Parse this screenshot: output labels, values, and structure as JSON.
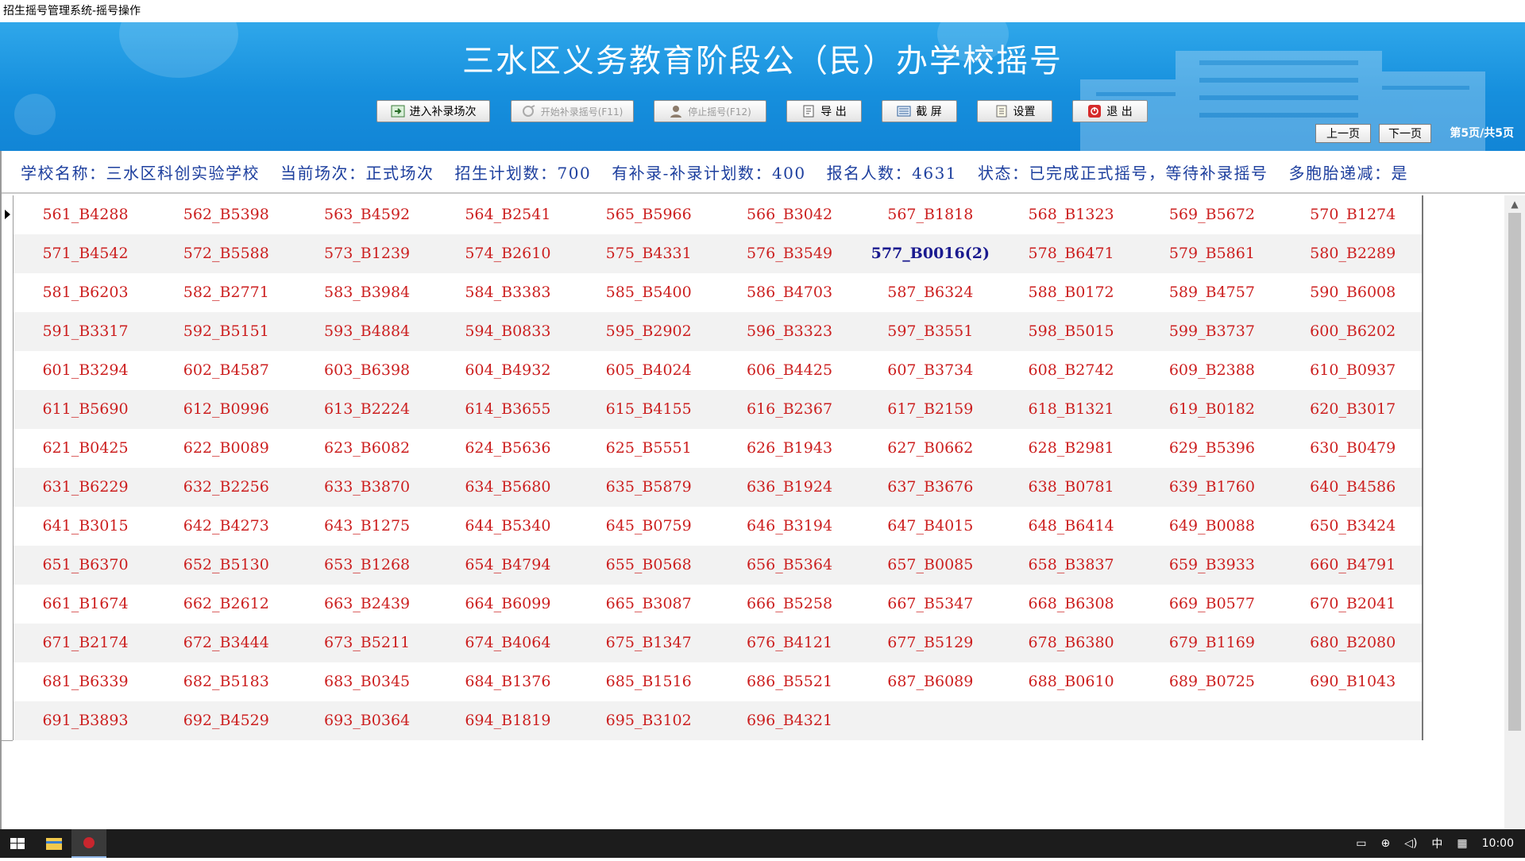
{
  "window": {
    "title": "招生摇号管理系统-摇号操作"
  },
  "banner": {
    "title": "三水区义务教育阶段公（民）办学校摇号"
  },
  "toolbar": {
    "buttons": [
      {
        "label": "进入补录场次",
        "icon": "enter-icon",
        "enabled": true
      },
      {
        "label": "开始补录摇号(F11)",
        "icon": "start-lottery-icon",
        "enabled": false
      },
      {
        "label": "停止摇号(F12)",
        "icon": "stop-lottery-icon",
        "enabled": false
      },
      {
        "label": "导 出",
        "icon": "export-icon",
        "enabled": true
      },
      {
        "label": "截 屏",
        "icon": "screenshot-icon",
        "enabled": true
      },
      {
        "label": "设置",
        "icon": "settings-icon",
        "enabled": true
      },
      {
        "label": "退 出",
        "icon": "exit-icon",
        "enabled": true
      }
    ],
    "prev_page": "上一页",
    "next_page": "下一页",
    "page_info": "第5页/共5页"
  },
  "info": {
    "school": "学校名称：三水区科创实验学校",
    "session": "当前场次：正式场次",
    "plan": "招生计划数：700",
    "supp_plan": "有补录-补录计划数：400",
    "applicants": "报名人数：4631",
    "status": "状态：已完成正式摇号，等待补录摇号",
    "multi": "多胞胎递减：是"
  },
  "grid": {
    "rows": [
      [
        "561_B4288",
        "562_B5398",
        "563_B4592",
        "564_B2541",
        "565_B5966",
        "566_B3042",
        "567_B1818",
        "568_B1323",
        "569_B5672",
        "570_B1274"
      ],
      [
        "571_B4542",
        "572_B5588",
        "573_B1239",
        "574_B2610",
        "575_B4331",
        "576_B3549",
        "577_B0016(2)",
        "578_B6471",
        "579_B5861",
        "580_B2289"
      ],
      [
        "581_B6203",
        "582_B2771",
        "583_B3984",
        "584_B3383",
        "585_B5400",
        "586_B4703",
        "587_B6324",
        "588_B0172",
        "589_B4757",
        "590_B6008"
      ],
      [
        "591_B3317",
        "592_B5151",
        "593_B4884",
        "594_B0833",
        "595_B2902",
        "596_B3323",
        "597_B3551",
        "598_B5015",
        "599_B3737",
        "600_B6202"
      ],
      [
        "601_B3294",
        "602_B4587",
        "603_B6398",
        "604_B4932",
        "605_B4024",
        "606_B4425",
        "607_B3734",
        "608_B2742",
        "609_B2388",
        "610_B0937"
      ],
      [
        "611_B5690",
        "612_B0996",
        "613_B2224",
        "614_B3655",
        "615_B4155",
        "616_B2367",
        "617_B2159",
        "618_B1321",
        "619_B0182",
        "620_B3017"
      ],
      [
        "621_B0425",
        "622_B0089",
        "623_B6082",
        "624_B5636",
        "625_B5551",
        "626_B1943",
        "627_B0662",
        "628_B2981",
        "629_B5396",
        "630_B0479"
      ],
      [
        "631_B6229",
        "632_B2256",
        "633_B3870",
        "634_B5680",
        "635_B5879",
        "636_B1924",
        "637_B3676",
        "638_B0781",
        "639_B1760",
        "640_B4586"
      ],
      [
        "641_B3015",
        "642_B4273",
        "643_B1275",
        "644_B5340",
        "645_B0759",
        "646_B3194",
        "647_B4015",
        "648_B6414",
        "649_B0088",
        "650_B3424"
      ],
      [
        "651_B6370",
        "652_B5130",
        "653_B1268",
        "654_B4794",
        "655_B0568",
        "656_B5364",
        "657_B0085",
        "658_B3837",
        "659_B3933",
        "660_B4791"
      ],
      [
        "661_B1674",
        "662_B2612",
        "663_B2439",
        "664_B6099",
        "665_B3087",
        "666_B5258",
        "667_B5347",
        "668_B6308",
        "669_B0577",
        "670_B2041"
      ],
      [
        "671_B2174",
        "672_B3444",
        "673_B5211",
        "674_B4064",
        "675_B1347",
        "676_B4121",
        "677_B5129",
        "678_B6380",
        "679_B1169",
        "680_B2080"
      ],
      [
        "681_B6339",
        "682_B5183",
        "683_B0345",
        "684_B1376",
        "685_B1516",
        "686_B5521",
        "687_B6089",
        "688_B0610",
        "689_B0725",
        "690_B1043"
      ],
      [
        "691_B3893",
        "692_B4529",
        "693_B0364",
        "694_B1819",
        "695_B3102",
        "696_B4321"
      ]
    ],
    "highlighted": "577_B0016(2)"
  },
  "taskbar": {
    "items": [
      "windows-start-icon",
      "file-explorer-icon",
      "lottery-app-icon"
    ],
    "ime": "中",
    "clock": "10:00"
  },
  "colors": {
    "banner": "#168fdd",
    "cell_text": "#cc1f1f",
    "info_text": "#1d3f9e",
    "highlight": "#1a1a8f"
  }
}
